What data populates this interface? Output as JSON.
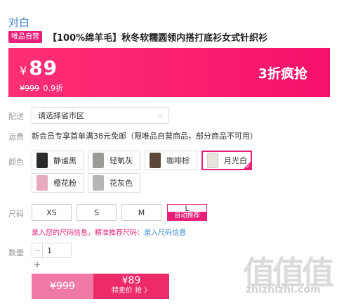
{
  "product": {
    "brand": "对白",
    "self_tag": "唯品自营",
    "title": "【100%绵羊毛】秋冬软糯圆领内搭打底衫女式针织衫"
  },
  "price": {
    "currency": "¥",
    "value": "89",
    "original": "¥999",
    "discount_small": "0.9折",
    "promo": "3折疯抢"
  },
  "delivery": {
    "label": "配送",
    "placeholder": "请选择省市区"
  },
  "shipping": {
    "label": "运费",
    "text": "新会员专享首单满38元免邮（限唯品自营商品，部分商品不可用）"
  },
  "colors": {
    "label": "颜色",
    "items": [
      {
        "label": "静谧黑",
        "swatch": "#2a2a2a"
      },
      {
        "label": "轻氧灰",
        "swatch": "#9a9a96"
      },
      {
        "label": "咖啡棕",
        "swatch": "#5b4638"
      },
      {
        "label": "月光白",
        "swatch": "#e8e4dc",
        "selected": true
      },
      {
        "label": "樱花粉",
        "swatch": "#e6a9c0"
      },
      {
        "label": "花灰色",
        "swatch": "#b5b5b5"
      }
    ]
  },
  "sizes": {
    "label": "尺码",
    "items": [
      "XS",
      "S",
      "M",
      "L"
    ],
    "selected_tag": "自动推荐",
    "hint": "录入您的尺码信息，精准推荐尺码：",
    "hint_link": "录入尺码信息"
  },
  "quantity": {
    "label": "数量",
    "value": "1",
    "minus": "−",
    "plus": "+"
  },
  "actions": {
    "original_price": "¥999",
    "buy_price": "¥89",
    "buy_label": "特卖价 抢 〉"
  },
  "watermark": {
    "logo": "值值值",
    "url": "zhizhizhi.com"
  },
  "colors_theme": {
    "accent": "#e8207a",
    "link": "#3b87cf"
  }
}
